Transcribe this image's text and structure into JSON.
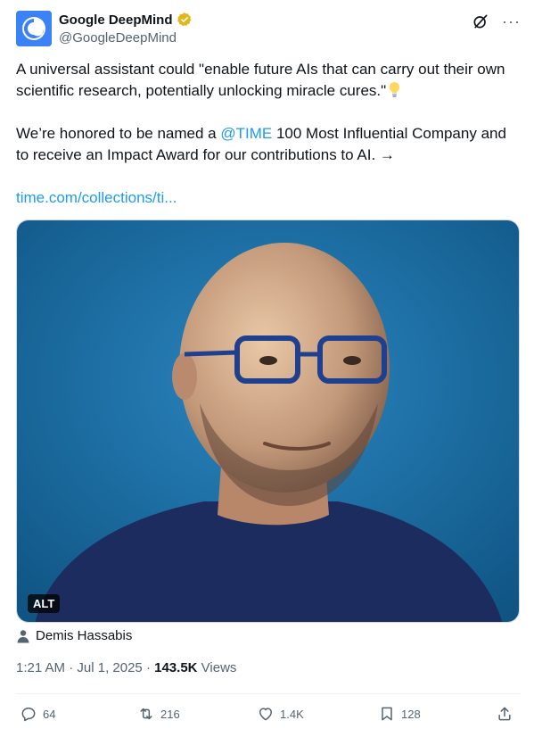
{
  "author": {
    "display_name": "Google DeepMind",
    "handle": "@GoogleDeepMind",
    "verified_badge": "gold-check",
    "avatar_icon": "deepmind-logo-icon"
  },
  "header_icons": {
    "grok": "grok-icon",
    "more": "···"
  },
  "tweet": {
    "line1": "A universal assistant could \"enable future AIs that can carry out their own scientific research, potentially unlocking miracle cures.\"",
    "line1_emoji": "lightbulb-icon",
    "line2_pre": "We’re honored to be named a ",
    "mention": "@TIME",
    "line2_post": " 100 Most Influential Company and to receive an Impact Award for our contributions to AI. →",
    "link": "time.com/collections/ti..."
  },
  "media": {
    "alt_label": "ALT",
    "background_color": "#1b6b9e"
  },
  "tagged_person": "Demis Hassabis",
  "meta": {
    "time": "1:21 AM",
    "sep1": " · ",
    "date": "Jul 1, 2025",
    "sep2": " · ",
    "views_count": "143.5K",
    "views_label": " Views"
  },
  "actions": {
    "replies": "64",
    "reposts": "216",
    "likes": "1.4K",
    "bookmarks": "128"
  },
  "colors": {
    "accent": "#1d9bf0",
    "secondary_text": "#536471",
    "verified_gold": "#e2b719"
  }
}
